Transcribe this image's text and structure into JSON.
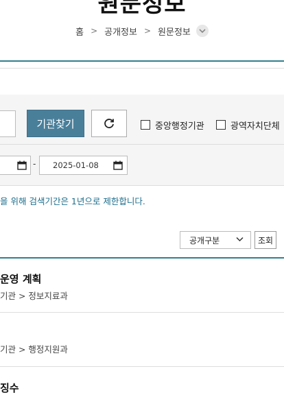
{
  "page": {
    "title": "원문정보"
  },
  "breadcrumb": {
    "items": [
      "홈",
      "공개정보",
      "원문정보"
    ],
    "separator": ">"
  },
  "search": {
    "find_agency_label": "기관찾기",
    "refresh_icon": "refresh-icon",
    "checkboxes": [
      {
        "label": "중앙행정기관",
        "checked": false
      },
      {
        "label": "광역자치단체",
        "checked": false
      }
    ],
    "date_from": "",
    "date_to": "2025-01-08",
    "date_separator": "-",
    "notice": "을 위해 검색기간은 1년으로 제한합니다."
  },
  "filter": {
    "disclosure_select": "공개구분",
    "search_button": "조회"
  },
  "results": [
    {
      "title": "운영 계획",
      "meta": "기관 > 정보지료과"
    },
    {
      "title": "",
      "meta": "기관 > 행정지원과"
    },
    {
      "title": "징수",
      "meta": ""
    }
  ],
  "colors": {
    "accent": "#4a7f9a",
    "teal_line": "#2f7f8e",
    "notice_text": "#1c6d8c"
  }
}
